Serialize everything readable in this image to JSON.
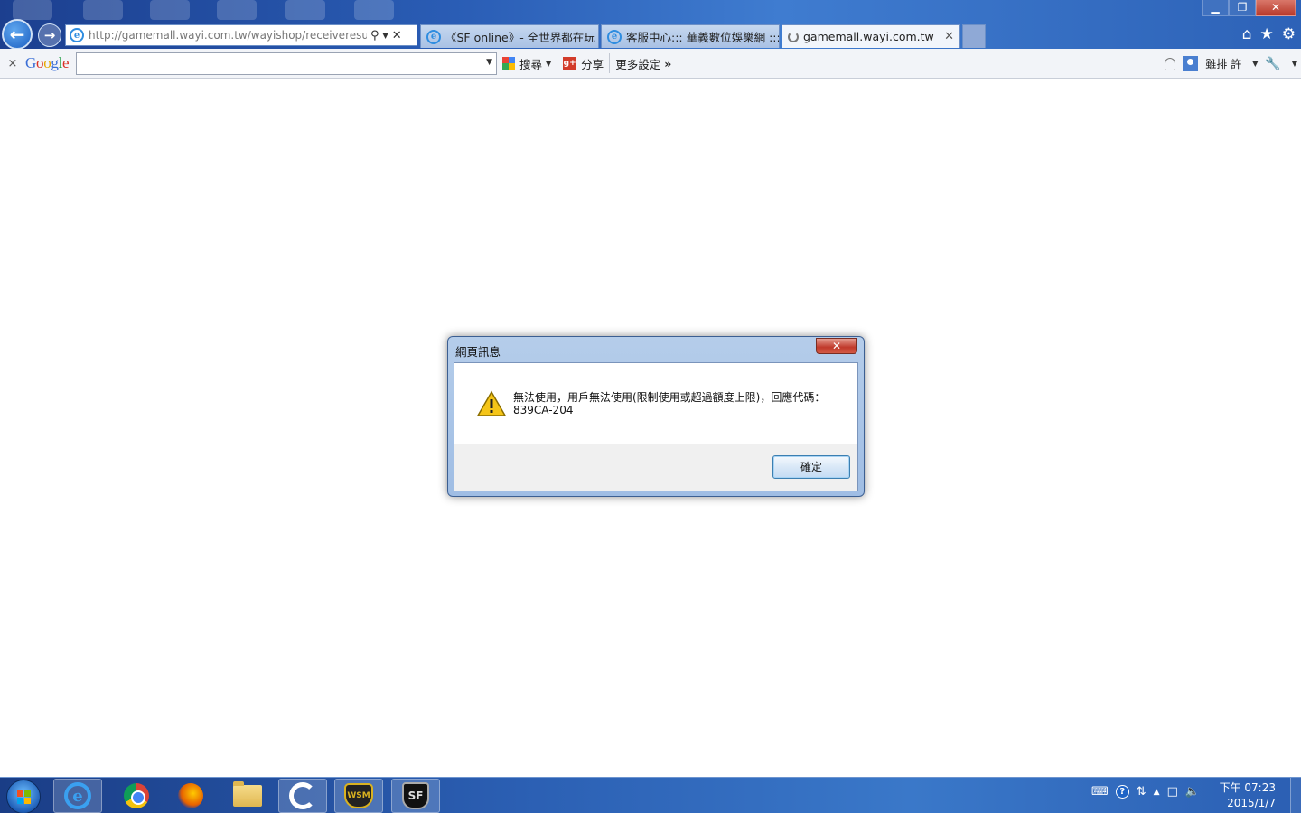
{
  "browser": {
    "address_url": "http://gamemall.wayi.com.tw/wayishop/receiveresult.a",
    "tabs": [
      {
        "title": "《SF online》- 全世界都在玩"
      },
      {
        "title": "客服中心::: 華義數位娛樂網 :::"
      },
      {
        "title": "gamemall.wayi.com.tw"
      }
    ],
    "window_controls": {
      "minimize": "▁",
      "maximize": "❐",
      "close": "✕"
    },
    "icons": [
      "back-arrow-icon",
      "forward-arrow-icon",
      "ie-icon",
      "search-icon",
      "refresh-icon",
      "close-icon",
      "home-icon",
      "star-icon",
      "gear-icon"
    ]
  },
  "google_toolbar": {
    "close_glyph": "×",
    "logo_letters": [
      "G",
      "o",
      "o",
      "g",
      "l",
      "e"
    ],
    "search_label": "搜尋",
    "share_label": "分享",
    "more_label": "更多設定",
    "more_glyph": "»",
    "user_name": "雖排 許",
    "icons": [
      "bell-icon",
      "user-icon",
      "wrench-icon",
      "google-plus-icon"
    ]
  },
  "dialog": {
    "title": "網頁訊息",
    "close_glyph": "✕",
    "message_line1": "無法使用，用戶無法使用(限制使用或超過額度上限)，回應代碼：",
    "message_line2": "839CA-204",
    "ok_label": "確定",
    "icon": "warning-icon"
  },
  "taskbar": {
    "apps": [
      "internet-explorer",
      "chrome",
      "firefox",
      "file-explorer",
      "launcher",
      "wsm",
      "sf-online"
    ],
    "wsm_label": "WSM",
    "sf_label": "SF",
    "time": "下午 07:23",
    "date": "2015/1/7",
    "tray_icons": [
      "keyboard-icon",
      "help-icon",
      "arrow-icon",
      "network-icon",
      "volume-icon"
    ]
  },
  "colors": {
    "title_bar": "#2a5db5",
    "dialog_frame": "#b5cdea",
    "dialog_close": "#c0392b",
    "taskbar": "#2b5fb3"
  }
}
